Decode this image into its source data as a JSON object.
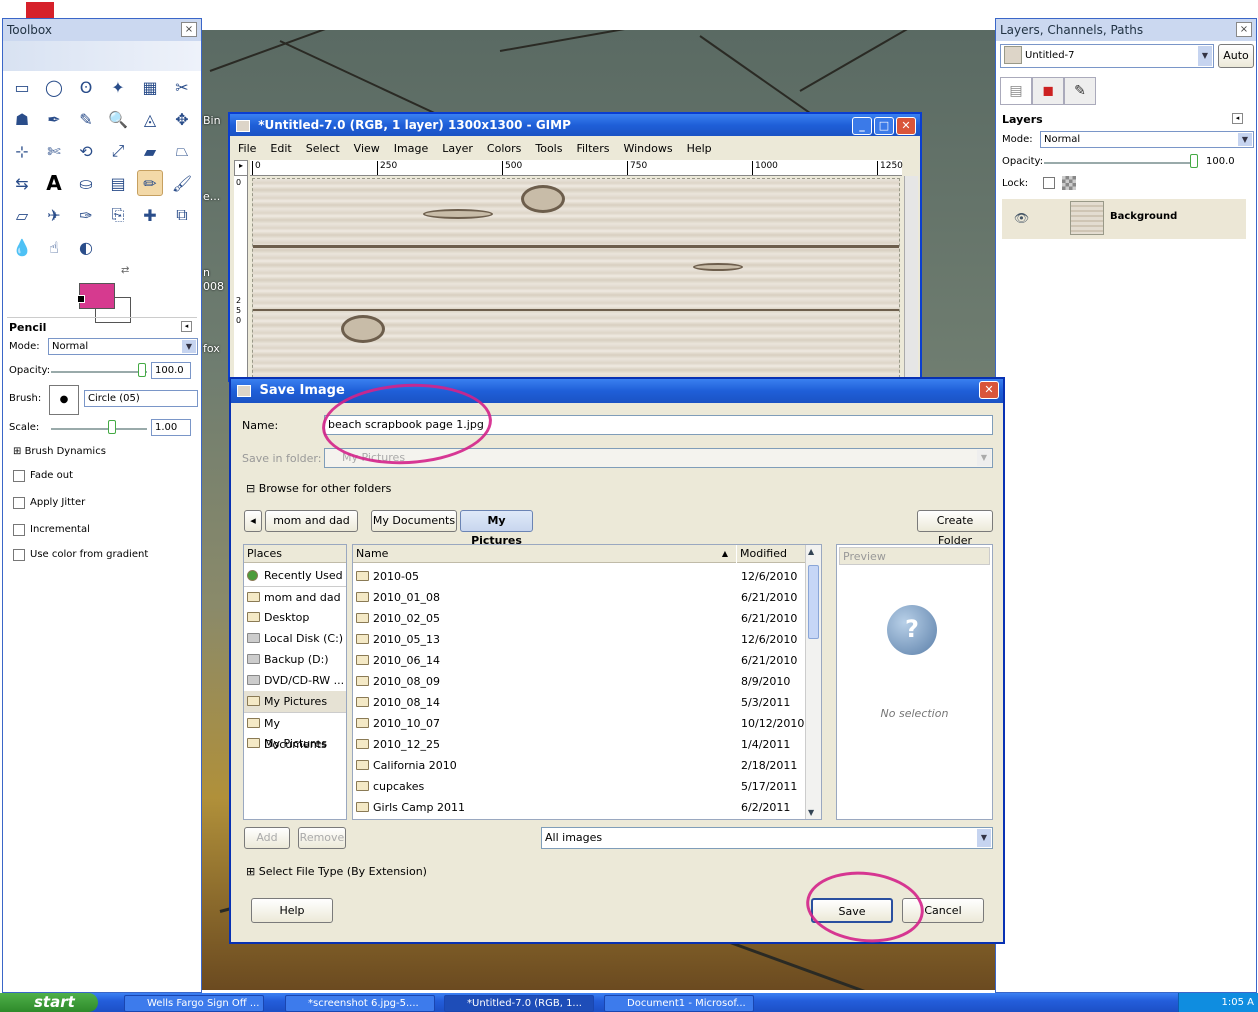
{
  "desktop": {
    "labels": [
      "Bin",
      "e...",
      "n",
      "008",
      "fox"
    ]
  },
  "toolbox": {
    "title": "Toolbox",
    "close": "×",
    "fg_color": "#d63a8f",
    "bg_color": "#ffffff",
    "tool_icons": [
      "rect-select-icon",
      "ellipse-select-icon",
      "free-select-icon",
      "fuzzy-select-icon",
      "color-select-icon",
      "scissors-icon",
      "foreground-select-icon",
      "paths-icon",
      "color-picker-icon",
      "zoom-icon",
      "measure-icon",
      "move-icon",
      "align-icon",
      "crop-icon",
      "rotate-icon",
      "scale-icon",
      "shear-icon",
      "perspective-icon",
      "flip-icon",
      "text-icon",
      "bucket-fill-icon",
      "blend-icon",
      "pencil-icon",
      "paintbrush-icon",
      "eraser-icon",
      "airbrush-icon",
      "ink-icon",
      "clone-icon",
      "heal-icon",
      "perspective-clone-icon",
      "blur-icon",
      "smudge-icon",
      "dodge-burn-icon"
    ],
    "options": {
      "title": "Pencil",
      "mode_label": "Mode:",
      "mode_value": "Normal",
      "opacity_label": "Opacity:",
      "opacity_value": "100.0",
      "brush_label": "Brush:",
      "brush_value": "Circle (05)",
      "scale_label": "Scale:",
      "scale_value": "1.00",
      "brush_dynamics": "Brush Dynamics",
      "fade_out": "Fade out",
      "apply_jitter": "Apply Jitter",
      "incremental": "Incremental",
      "use_gradient": "Use color from gradient"
    }
  },
  "layers_dock": {
    "title": "Layers, Channels, Paths",
    "image_select": "Untitled-7",
    "auto_button": "Auto",
    "panel_title": "Layers",
    "mode_label": "Mode:",
    "mode_value": "Normal",
    "opacity_label": "Opacity:",
    "opacity_value": "100.0",
    "lock_label": "Lock:",
    "layer_name": "Background"
  },
  "image_window": {
    "title": "*Untitled-7.0 (RGB, 1 layer) 1300x1300 - GIMP",
    "menus": [
      "File",
      "Edit",
      "Select",
      "View",
      "Image",
      "Layer",
      "Colors",
      "Tools",
      "Filters",
      "Windows",
      "Help"
    ],
    "ruler_ticks": [
      "0",
      "250",
      "500",
      "750",
      "1000",
      "1250"
    ],
    "vruler_ticks": [
      "0",
      "2",
      "5",
      "0"
    ]
  },
  "save_dialog": {
    "title": "Save Image",
    "name_label": "Name:",
    "name_value": "beach scrapbook page 1.jpg",
    "folder_label": "Save in folder:",
    "folder_value": "My Pictures",
    "browse_label": "Browse for other folders",
    "path_buttons": [
      "mom and dad",
      "My Documents",
      "My Pictures"
    ],
    "create_folder": "Create Folder",
    "places_header": "Places",
    "places": [
      "Recently Used",
      "mom and dad",
      "Desktop",
      "Local Disk (C:)",
      "Backup (D:)",
      "DVD/CD-RW ...",
      "My Pictures",
      "My Documents",
      "My Pictures"
    ],
    "name_header": "Name",
    "modified_header": "Modified",
    "files": [
      {
        "name": "2010-05",
        "date": "12/6/2010"
      },
      {
        "name": "2010_01_08",
        "date": "6/21/2010"
      },
      {
        "name": "2010_02_05",
        "date": "6/21/2010"
      },
      {
        "name": "2010_05_13",
        "date": "12/6/2010"
      },
      {
        "name": "2010_06_14",
        "date": "6/21/2010"
      },
      {
        "name": "2010_08_09",
        "date": "8/9/2010"
      },
      {
        "name": "2010_08_14",
        "date": "5/3/2011"
      },
      {
        "name": "2010_10_07",
        "date": "10/12/2010"
      },
      {
        "name": "2010_12_25",
        "date": "1/4/2011"
      },
      {
        "name": "California 2010",
        "date": "2/18/2011"
      },
      {
        "name": "cupcakes",
        "date": "5/17/2011"
      },
      {
        "name": "Girls Camp 2011",
        "date": "6/2/2011"
      }
    ],
    "preview_header": "Preview",
    "no_selection": "No selection",
    "add": "Add",
    "remove": "Remove",
    "filter_value": "All images",
    "file_type_label": "Select File Type (By Extension)",
    "help": "Help",
    "save": "Save",
    "cancel": "Cancel",
    "annotation_color": "#d4228a"
  },
  "taskbar": {
    "start": "start",
    "tasks": [
      "Wells Fargo Sign Off ...",
      "*screenshot 6.jpg-5....",
      "*Untitled-7.0 (RGB, 1...",
      "Document1 - Microsof..."
    ],
    "clock": "1:05 A"
  }
}
